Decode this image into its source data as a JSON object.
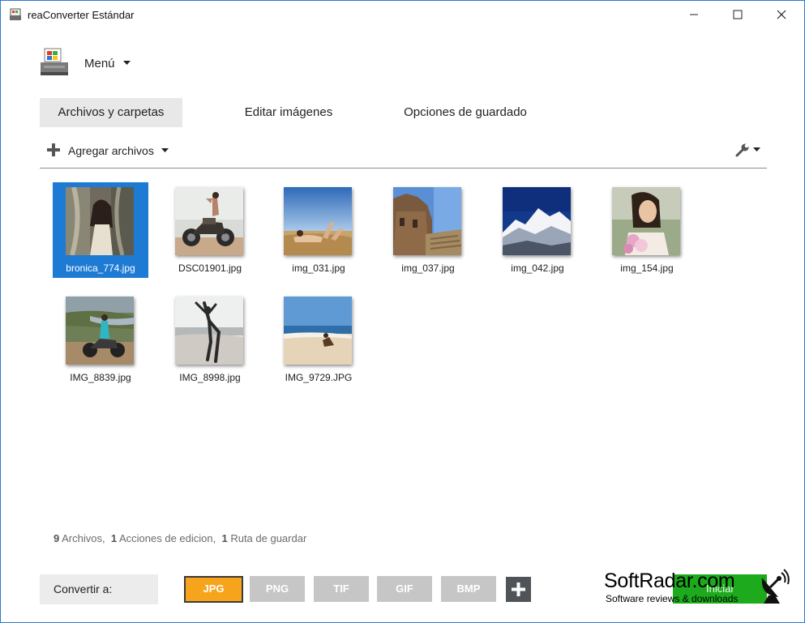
{
  "window": {
    "title": "reaConverter Estándar"
  },
  "menu": {
    "label": "Menú"
  },
  "tabs": [
    {
      "label": "Archivos y carpetas",
      "active": true
    },
    {
      "label": "Editar imágenes",
      "active": false
    },
    {
      "label": "Opciones de guardado",
      "active": false
    }
  ],
  "toolbar": {
    "add_files_label": "Agregar archivos",
    "settings_icon": "wrench-icon"
  },
  "files": [
    {
      "name": "bronica_774.jpg",
      "selected": true
    },
    {
      "name": "DSC01901.jpg",
      "selected": false
    },
    {
      "name": "img_031.jpg",
      "selected": false
    },
    {
      "name": "img_037.jpg",
      "selected": false
    },
    {
      "name": "img_042.jpg",
      "selected": false
    },
    {
      "name": "img_154.jpg",
      "selected": false
    },
    {
      "name": "IMG_8839.jpg",
      "selected": false
    },
    {
      "name": "IMG_8998.jpg",
      "selected": false
    },
    {
      "name": "IMG_9729.JPG",
      "selected": false
    }
  ],
  "status": {
    "files_count": "9",
    "files_label": "Archivos,",
    "actions_count": "1",
    "actions_label": "Acciones de edicion,",
    "paths_count": "1",
    "paths_label": "Ruta de guardar"
  },
  "convert": {
    "label": "Convertir a:",
    "formats": [
      {
        "label": "JPG",
        "active": true
      },
      {
        "label": "PNG",
        "active": false
      },
      {
        "label": "TIF",
        "active": false
      },
      {
        "label": "GIF",
        "active": false
      },
      {
        "label": "BMP",
        "active": false
      }
    ],
    "add_icon": "plus-icon"
  },
  "start_button": {
    "label": "Iniciar"
  },
  "watermark": {
    "title": "SoftRadar.com",
    "subtitle": "Software reviews & downloads"
  },
  "colors": {
    "selection": "#1e7bd3",
    "accent_format": "#f7a41d",
    "inactive_format": "#c6c6c6",
    "window_border": "#2b79d0"
  }
}
